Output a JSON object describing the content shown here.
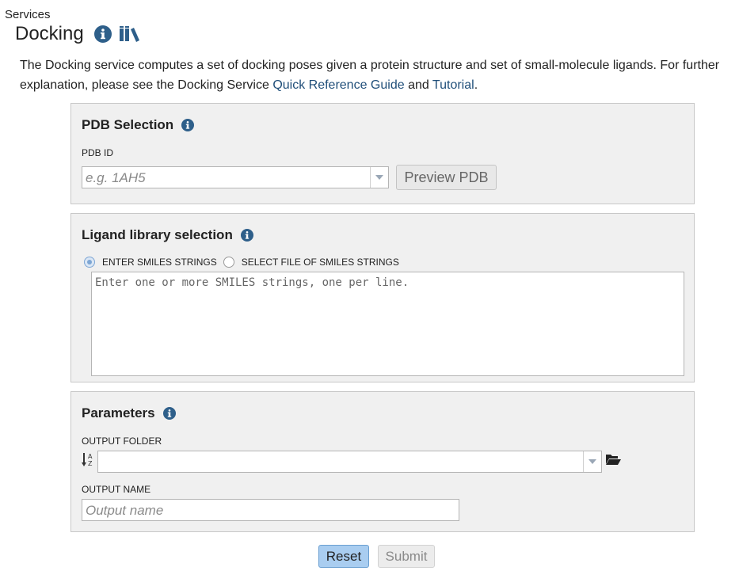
{
  "breadcrumb": "Services",
  "page": {
    "title": "Docking"
  },
  "intro": {
    "text_before": "The Docking service computes a set of docking poses given a protein structure and set of small-molecule ligands. For further explanation, please see the Docking Service ",
    "link1": "Quick Reference Guide",
    "middle": " and ",
    "link2": "Tutorial",
    "end": "."
  },
  "pdb_section": {
    "title": "PDB Selection",
    "field_label": "PDB ID",
    "placeholder": "e.g. 1AH5",
    "preview_button": "Preview PDB"
  },
  "ligand_section": {
    "title": "Ligand library selection",
    "radio1": "ENTER SMILES STRINGS",
    "radio2": "SELECT FILE OF SMILES STRINGS",
    "selected": "ENTER SMILES STRINGS",
    "textarea_placeholder": "Enter one or more SMILES strings, one per line."
  },
  "params_section": {
    "title": "Parameters",
    "output_folder_label": "OUTPUT FOLDER",
    "output_folder_value": "",
    "output_name_label": "OUTPUT NAME",
    "output_name_placeholder": "Output name"
  },
  "buttons": {
    "reset": "Reset",
    "submit": "Submit"
  },
  "colors": {
    "accent": "#2e5f8a",
    "link": "#1f4e79",
    "panel_bg": "#f0f0f0",
    "reset_bg": "#a9cdf0"
  },
  "icons": [
    "info-icon",
    "library-icon",
    "chevron-down-icon",
    "sort-az-icon",
    "folder-open-icon"
  ]
}
